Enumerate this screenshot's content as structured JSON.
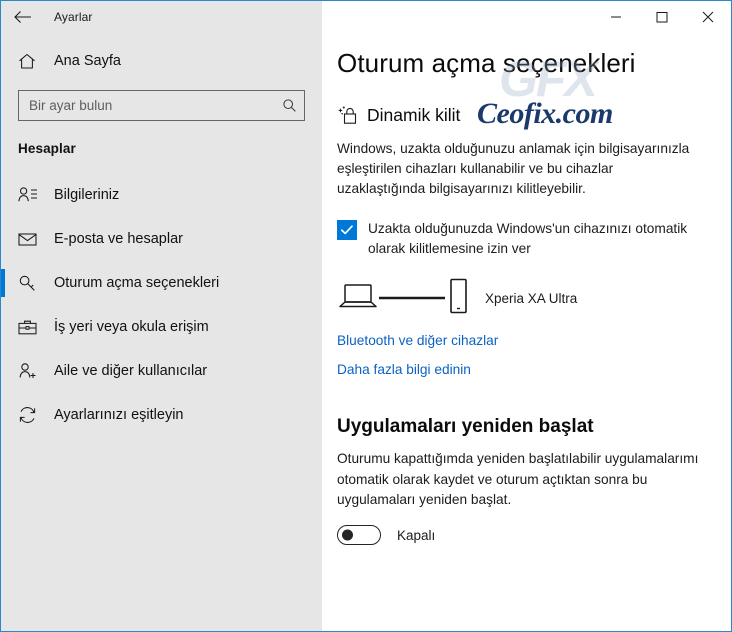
{
  "window": {
    "title": "Ayarlar",
    "back_icon": "back-arrow-icon",
    "controls": {
      "minimize": "minimize-icon",
      "maximize": "maximize-icon",
      "close": "close-icon"
    },
    "border_color": "#2a8ac9"
  },
  "sidebar": {
    "background": "#e6e6e6",
    "home": {
      "label": "Ana Sayfa",
      "icon": "home-icon"
    },
    "search": {
      "placeholder": "Bir ayar bulun",
      "value": "",
      "icon": "search-icon"
    },
    "group_title": "Hesaplar",
    "accent_color": "#0078d7",
    "items": [
      {
        "label": "Bilgileriniz",
        "icon": "user-info-icon",
        "selected": false
      },
      {
        "label": "E-posta ve hesaplar",
        "icon": "mail-icon",
        "selected": false
      },
      {
        "label": "Oturum açma seçenekleri",
        "icon": "key-icon",
        "selected": true
      },
      {
        "label": "İş yeri veya okula erişim",
        "icon": "briefcase-icon",
        "selected": false
      },
      {
        "label": "Aile ve diğer kullanıcılar",
        "icon": "add-user-icon",
        "selected": false
      },
      {
        "label": "Ayarlarınızı eşitleyin",
        "icon": "sync-icon",
        "selected": false
      }
    ]
  },
  "main": {
    "page_title": "Oturum açma seçenekleri",
    "dynamic_lock": {
      "heading": "Dinamik kilit",
      "heading_icon": "dynamic-lock-icon",
      "description": "Windows, uzakta olduğunuzu anlamak için bilgisayarınızla eşleştirilen cihazları kullanabilir ve bu cihazlar uzaklaştığında bilgisayarınızı kilitleyebilir.",
      "checkbox": {
        "label": "Uzakta olduğunuzda Windows'un cihazınızı otomatik olarak kilitlemesine izin ver",
        "checked": true,
        "color": "#0078d7"
      },
      "paired_device": {
        "name": "Xperia XA Ultra",
        "pc_icon": "laptop-icon",
        "link_icon": "connection-line-icon",
        "phone_icon": "phone-icon"
      },
      "links": [
        {
          "label": "Bluetooth ve diğer cihazlar",
          "color": "#0c62c4"
        },
        {
          "label": "Daha fazla bilgi edinin",
          "color": "#0c62c4"
        }
      ]
    },
    "restart_apps": {
      "heading": "Uygulamaları yeniden başlat",
      "description": "Oturumu kapattığımda yeniden başlatılabilir uygulamalarımı otomatik olarak kaydet ve oturum açtıktan sonra bu uygulamaları yeniden başlat.",
      "toggle": {
        "state_label": "Kapalı",
        "on": false
      }
    }
  },
  "watermark": {
    "logo_text": "GFX",
    "site_text": "Ceofix.com",
    "site_color": "#1b3a6b"
  }
}
